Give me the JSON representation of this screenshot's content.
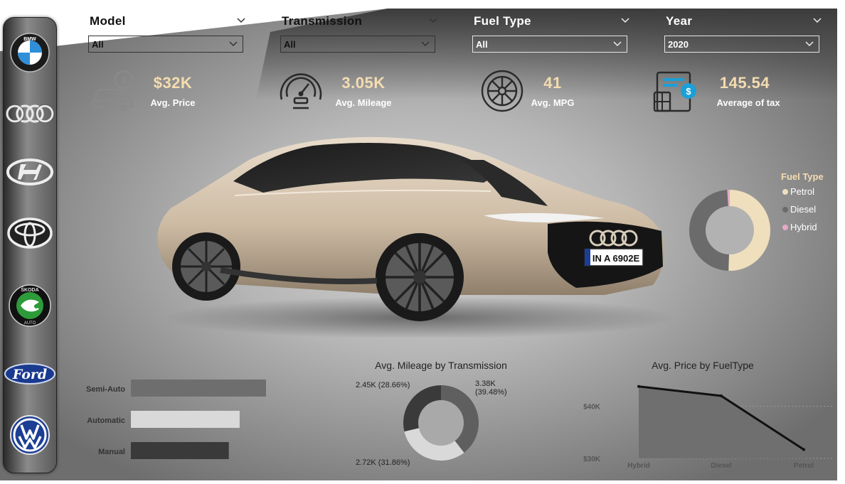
{
  "brands": [
    {
      "name": "BMW",
      "icon": "bmw-logo-icon"
    },
    {
      "name": "Audi",
      "icon": "audi-logo-icon"
    },
    {
      "name": "Hyundai",
      "icon": "hyundai-logo-icon"
    },
    {
      "name": "Toyota",
      "icon": "toyota-logo-icon"
    },
    {
      "name": "Skoda",
      "icon": "skoda-logo-icon"
    },
    {
      "name": "Ford",
      "icon": "ford-logo-icon"
    },
    {
      "name": "Volkswagen",
      "icon": "vw-logo-icon"
    }
  ],
  "bmw_logo_text": "BMW",
  "skoda_logo_text": "ŠKODA",
  "skoda_logo_sub": "AUTO",
  "ford_logo_text": "Ford",
  "filters": {
    "model": {
      "label": "Model",
      "value": "All"
    },
    "transmission": {
      "label": "Transmission",
      "value": "All"
    },
    "fuel": {
      "label": "Fuel Type",
      "value": "All"
    },
    "year": {
      "label": "Year",
      "value": "2020"
    }
  },
  "kpis": {
    "price": {
      "value": "$32K",
      "label": "Avg. Price",
      "icon": "car-price-icon"
    },
    "mileage": {
      "value": "3.05K",
      "label": "Avg. Mileage",
      "icon": "speedometer-icon"
    },
    "mpg": {
      "value": "41",
      "label": "Avg. MPG",
      "icon": "wheel-icon"
    },
    "tax": {
      "value": "145.54",
      "label": "Average of tax",
      "icon": "tax-calculator-icon"
    }
  },
  "car_plate": "IN A 6902E",
  "colors": {
    "accent": "#f5dcb0",
    "petrol": "#f0dfbd",
    "diesel": "#6b6b6b",
    "hybrid": "#e5a9c6"
  },
  "chart_data": [
    {
      "type": "pie",
      "title": "",
      "legend_title": "Fuel Type",
      "labels": [
        "Petrol",
        "Diesel",
        "Hybrid"
      ],
      "values": [
        50.5,
        48.5,
        1.0
      ],
      "colors": [
        "#f0dfbd",
        "#6b6b6b",
        "#e5a9c6"
      ],
      "legend": "right"
    },
    {
      "type": "bar",
      "title": "",
      "orientation": "horizontal",
      "categories": [
        "Semi-Auto",
        "Automatic",
        "Manual"
      ],
      "values": [
        3.38,
        2.72,
        2.45
      ],
      "colors": [
        "#6e6e6e",
        "#d9d9d9",
        "#3a3a3a"
      ]
    },
    {
      "type": "pie",
      "title": "Avg. Mileage by Transmission",
      "labels": [
        "Semi-Auto",
        "Automatic",
        "Manual"
      ],
      "values": [
        3.38,
        2.72,
        2.45
      ],
      "data_labels": [
        "3.38K (39.48%)",
        "2.72K (31.86%)",
        "2.45K (28.66%)"
      ],
      "colors": [
        "#5f5f5f",
        "#d9d9d9",
        "#3a3a3a"
      ]
    },
    {
      "type": "area",
      "title": "Avg. Price by FuelType",
      "categories": [
        "Hybrid",
        "Diesel",
        "Petrol"
      ],
      "values": [
        43.8,
        42.0,
        31.7
      ],
      "ylim": [
        30,
        45
      ],
      "yticks": [
        30,
        40
      ],
      "ytick_labels": [
        "$30K",
        "$40K"
      ]
    }
  ]
}
